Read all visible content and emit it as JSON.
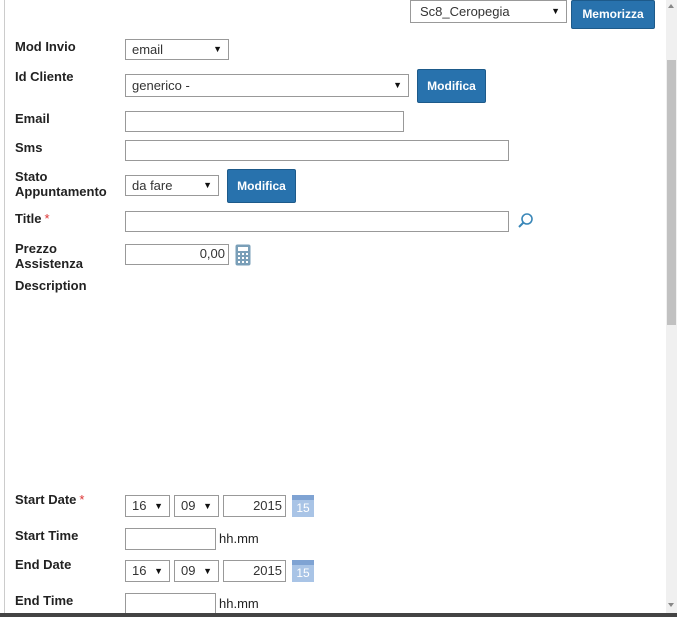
{
  "toolbar": {
    "profile_select": "Sc8_Ceropegia",
    "save_label": "Memorizza"
  },
  "form": {
    "mod_invio": {
      "label": "Mod Invio",
      "value": "email"
    },
    "id_cliente": {
      "label": "Id Cliente",
      "value": "generico -",
      "button": "Modifica"
    },
    "email": {
      "label": "Email",
      "value": ""
    },
    "sms": {
      "label": "Sms",
      "value": ""
    },
    "stato": {
      "label_line1": "Stato",
      "label_line2": "Appuntamento",
      "value": "da fare",
      "button": "Modifica"
    },
    "title": {
      "label": "Title",
      "required": "*",
      "value": ""
    },
    "prezzo": {
      "label_line1": "Prezzo",
      "label_line2": "Assistenza",
      "value": "0,00"
    },
    "description": {
      "label": "Description"
    },
    "start_date": {
      "label": "Start Date",
      "required": "*",
      "day": "16",
      "month": "09",
      "year": "2015",
      "calendar_day": "15"
    },
    "start_time": {
      "label": "Start Time",
      "value": "",
      "hint": "hh.mm"
    },
    "end_date": {
      "label": "End Date",
      "day": "16",
      "month": "09",
      "year": "2015",
      "calendar_day": "15"
    },
    "end_time": {
      "label": "End Time",
      "value": "",
      "hint": "hh.mm"
    }
  },
  "colors": {
    "button": "#2872ad",
    "calendar": "#a9c4e6"
  }
}
